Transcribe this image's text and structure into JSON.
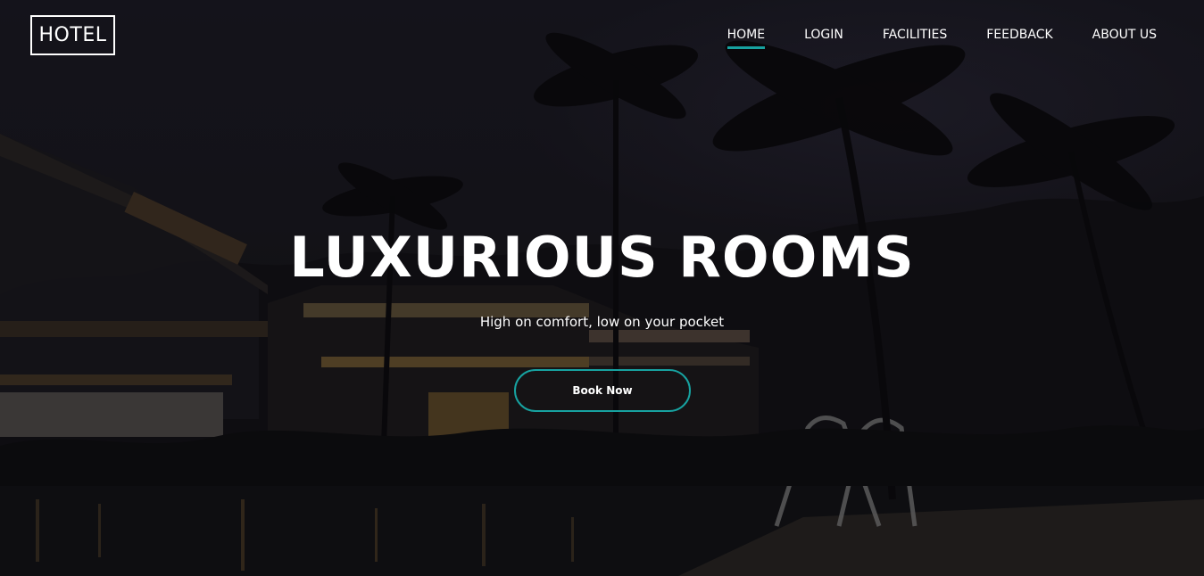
{
  "header": {
    "logo_text": "HOTEL",
    "nav": [
      {
        "label": "HOME",
        "active": true
      },
      {
        "label": "LOGIN",
        "active": false
      },
      {
        "label": "FACILITIES",
        "active": false
      },
      {
        "label": "FEEDBACK",
        "active": false
      },
      {
        "label": "ABOUT US",
        "active": false
      }
    ]
  },
  "hero": {
    "headline": "LUXURIOUS ROOMS",
    "tagline": "High on comfort, low on your pocket",
    "cta_label": "Book Now"
  },
  "colors": {
    "accent": "#17a2a0",
    "text": "#ffffff",
    "background": "#16141a"
  }
}
